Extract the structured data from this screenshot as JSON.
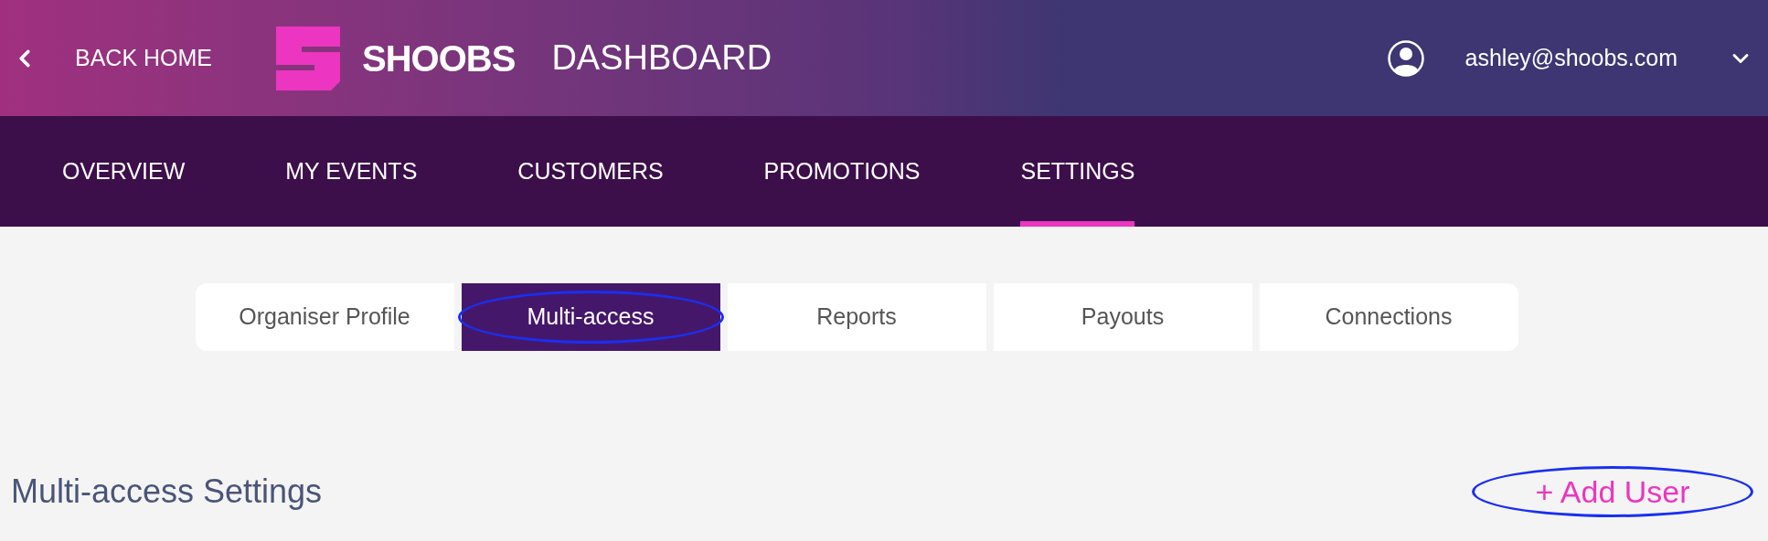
{
  "header": {
    "back_link": "BACK HOME",
    "logo_text": "SHOOBS",
    "title": "DASHBOARD",
    "user_email": "ashley@shoobs.com"
  },
  "nav": [
    {
      "label": "OVERVIEW",
      "selected": false
    },
    {
      "label": "MY EVENTS",
      "selected": false
    },
    {
      "label": "CUSTOMERS",
      "selected": false
    },
    {
      "label": "PROMOTIONS",
      "selected": false
    },
    {
      "label": "SETTINGS",
      "selected": true
    }
  ],
  "settings_tabs": [
    {
      "label": "Organiser Profile",
      "selected": false,
      "circled": false
    },
    {
      "label": "Multi-access",
      "selected": true,
      "circled": true
    },
    {
      "label": "Reports",
      "selected": false,
      "circled": false
    },
    {
      "label": "Payouts",
      "selected": false,
      "circled": false
    },
    {
      "label": "Connections",
      "selected": false,
      "circled": false
    }
  ],
  "section": {
    "title": "Multi-access Settings",
    "add_button": "+ Add User",
    "add_button_circled": true
  }
}
